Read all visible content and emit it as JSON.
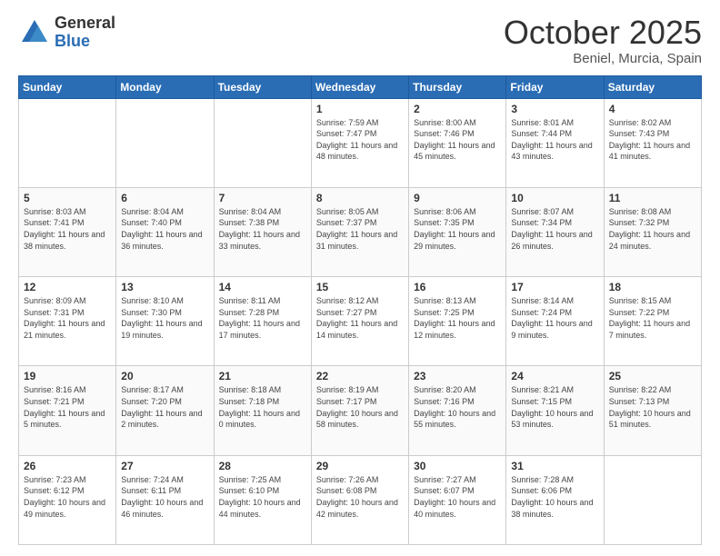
{
  "header": {
    "logo_general": "General",
    "logo_blue": "Blue",
    "month_title": "October 2025",
    "location": "Beniel, Murcia, Spain"
  },
  "days_of_week": [
    "Sunday",
    "Monday",
    "Tuesday",
    "Wednesday",
    "Thursday",
    "Friday",
    "Saturday"
  ],
  "weeks": [
    [
      {
        "day": "",
        "sunrise": "",
        "sunset": "",
        "daylight": ""
      },
      {
        "day": "",
        "sunrise": "",
        "sunset": "",
        "daylight": ""
      },
      {
        "day": "",
        "sunrise": "",
        "sunset": "",
        "daylight": ""
      },
      {
        "day": "1",
        "sunrise": "Sunrise: 7:59 AM",
        "sunset": "Sunset: 7:47 PM",
        "daylight": "Daylight: 11 hours and 48 minutes."
      },
      {
        "day": "2",
        "sunrise": "Sunrise: 8:00 AM",
        "sunset": "Sunset: 7:46 PM",
        "daylight": "Daylight: 11 hours and 45 minutes."
      },
      {
        "day": "3",
        "sunrise": "Sunrise: 8:01 AM",
        "sunset": "Sunset: 7:44 PM",
        "daylight": "Daylight: 11 hours and 43 minutes."
      },
      {
        "day": "4",
        "sunrise": "Sunrise: 8:02 AM",
        "sunset": "Sunset: 7:43 PM",
        "daylight": "Daylight: 11 hours and 41 minutes."
      }
    ],
    [
      {
        "day": "5",
        "sunrise": "Sunrise: 8:03 AM",
        "sunset": "Sunset: 7:41 PM",
        "daylight": "Daylight: 11 hours and 38 minutes."
      },
      {
        "day": "6",
        "sunrise": "Sunrise: 8:04 AM",
        "sunset": "Sunset: 7:40 PM",
        "daylight": "Daylight: 11 hours and 36 minutes."
      },
      {
        "day": "7",
        "sunrise": "Sunrise: 8:04 AM",
        "sunset": "Sunset: 7:38 PM",
        "daylight": "Daylight: 11 hours and 33 minutes."
      },
      {
        "day": "8",
        "sunrise": "Sunrise: 8:05 AM",
        "sunset": "Sunset: 7:37 PM",
        "daylight": "Daylight: 11 hours and 31 minutes."
      },
      {
        "day": "9",
        "sunrise": "Sunrise: 8:06 AM",
        "sunset": "Sunset: 7:35 PM",
        "daylight": "Daylight: 11 hours and 29 minutes."
      },
      {
        "day": "10",
        "sunrise": "Sunrise: 8:07 AM",
        "sunset": "Sunset: 7:34 PM",
        "daylight": "Daylight: 11 hours and 26 minutes."
      },
      {
        "day": "11",
        "sunrise": "Sunrise: 8:08 AM",
        "sunset": "Sunset: 7:32 PM",
        "daylight": "Daylight: 11 hours and 24 minutes."
      }
    ],
    [
      {
        "day": "12",
        "sunrise": "Sunrise: 8:09 AM",
        "sunset": "Sunset: 7:31 PM",
        "daylight": "Daylight: 11 hours and 21 minutes."
      },
      {
        "day": "13",
        "sunrise": "Sunrise: 8:10 AM",
        "sunset": "Sunset: 7:30 PM",
        "daylight": "Daylight: 11 hours and 19 minutes."
      },
      {
        "day": "14",
        "sunrise": "Sunrise: 8:11 AM",
        "sunset": "Sunset: 7:28 PM",
        "daylight": "Daylight: 11 hours and 17 minutes."
      },
      {
        "day": "15",
        "sunrise": "Sunrise: 8:12 AM",
        "sunset": "Sunset: 7:27 PM",
        "daylight": "Daylight: 11 hours and 14 minutes."
      },
      {
        "day": "16",
        "sunrise": "Sunrise: 8:13 AM",
        "sunset": "Sunset: 7:25 PM",
        "daylight": "Daylight: 11 hours and 12 minutes."
      },
      {
        "day": "17",
        "sunrise": "Sunrise: 8:14 AM",
        "sunset": "Sunset: 7:24 PM",
        "daylight": "Daylight: 11 hours and 9 minutes."
      },
      {
        "day": "18",
        "sunrise": "Sunrise: 8:15 AM",
        "sunset": "Sunset: 7:22 PM",
        "daylight": "Daylight: 11 hours and 7 minutes."
      }
    ],
    [
      {
        "day": "19",
        "sunrise": "Sunrise: 8:16 AM",
        "sunset": "Sunset: 7:21 PM",
        "daylight": "Daylight: 11 hours and 5 minutes."
      },
      {
        "day": "20",
        "sunrise": "Sunrise: 8:17 AM",
        "sunset": "Sunset: 7:20 PM",
        "daylight": "Daylight: 11 hours and 2 minutes."
      },
      {
        "day": "21",
        "sunrise": "Sunrise: 8:18 AM",
        "sunset": "Sunset: 7:18 PM",
        "daylight": "Daylight: 11 hours and 0 minutes."
      },
      {
        "day": "22",
        "sunrise": "Sunrise: 8:19 AM",
        "sunset": "Sunset: 7:17 PM",
        "daylight": "Daylight: 10 hours and 58 minutes."
      },
      {
        "day": "23",
        "sunrise": "Sunrise: 8:20 AM",
        "sunset": "Sunset: 7:16 PM",
        "daylight": "Daylight: 10 hours and 55 minutes."
      },
      {
        "day": "24",
        "sunrise": "Sunrise: 8:21 AM",
        "sunset": "Sunset: 7:15 PM",
        "daylight": "Daylight: 10 hours and 53 minutes."
      },
      {
        "day": "25",
        "sunrise": "Sunrise: 8:22 AM",
        "sunset": "Sunset: 7:13 PM",
        "daylight": "Daylight: 10 hours and 51 minutes."
      }
    ],
    [
      {
        "day": "26",
        "sunrise": "Sunrise: 7:23 AM",
        "sunset": "Sunset: 6:12 PM",
        "daylight": "Daylight: 10 hours and 49 minutes."
      },
      {
        "day": "27",
        "sunrise": "Sunrise: 7:24 AM",
        "sunset": "Sunset: 6:11 PM",
        "daylight": "Daylight: 10 hours and 46 minutes."
      },
      {
        "day": "28",
        "sunrise": "Sunrise: 7:25 AM",
        "sunset": "Sunset: 6:10 PM",
        "daylight": "Daylight: 10 hours and 44 minutes."
      },
      {
        "day": "29",
        "sunrise": "Sunrise: 7:26 AM",
        "sunset": "Sunset: 6:08 PM",
        "daylight": "Daylight: 10 hours and 42 minutes."
      },
      {
        "day": "30",
        "sunrise": "Sunrise: 7:27 AM",
        "sunset": "Sunset: 6:07 PM",
        "daylight": "Daylight: 10 hours and 40 minutes."
      },
      {
        "day": "31",
        "sunrise": "Sunrise: 7:28 AM",
        "sunset": "Sunset: 6:06 PM",
        "daylight": "Daylight: 10 hours and 38 minutes."
      },
      {
        "day": "",
        "sunrise": "",
        "sunset": "",
        "daylight": ""
      }
    ]
  ]
}
